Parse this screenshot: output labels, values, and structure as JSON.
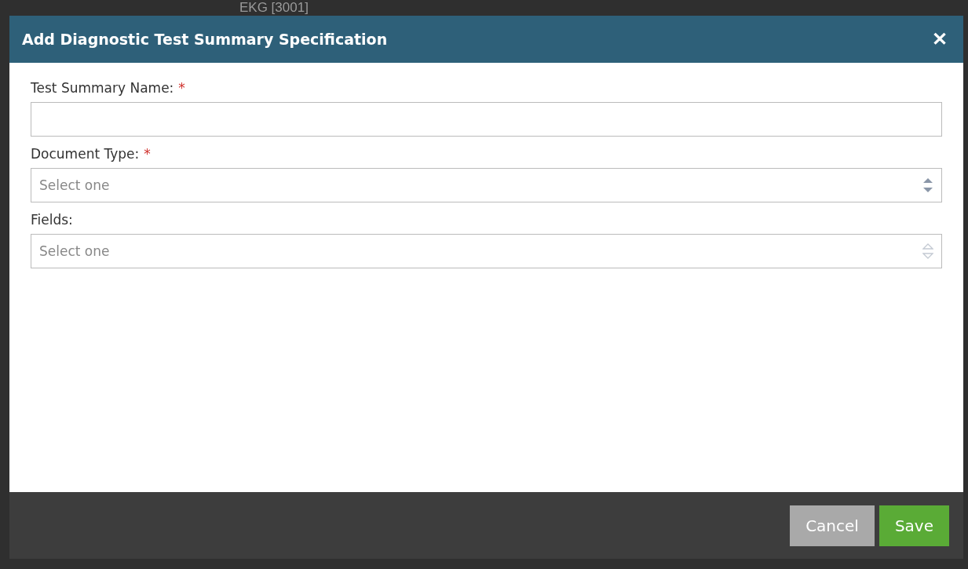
{
  "background": {
    "heading": "EKG [3001]"
  },
  "dialog": {
    "title": "Add Diagnostic Test Summary Specification",
    "close": "✕",
    "fields": [
      {
        "kind": "text",
        "label": "Test Summary Name:",
        "required_mark": "*"
      },
      {
        "kind": "select",
        "label": "Document Type:",
        "required_mark": "*",
        "placeholder": "Select one",
        "disabled": false
      },
      {
        "kind": "select",
        "label": "Fields:",
        "placeholder": "Select one",
        "disabled": true
      }
    ],
    "buttons": [
      {
        "label": "Cancel",
        "kind": "secondary"
      },
      {
        "label": "Save",
        "kind": "primary"
      }
    ]
  }
}
